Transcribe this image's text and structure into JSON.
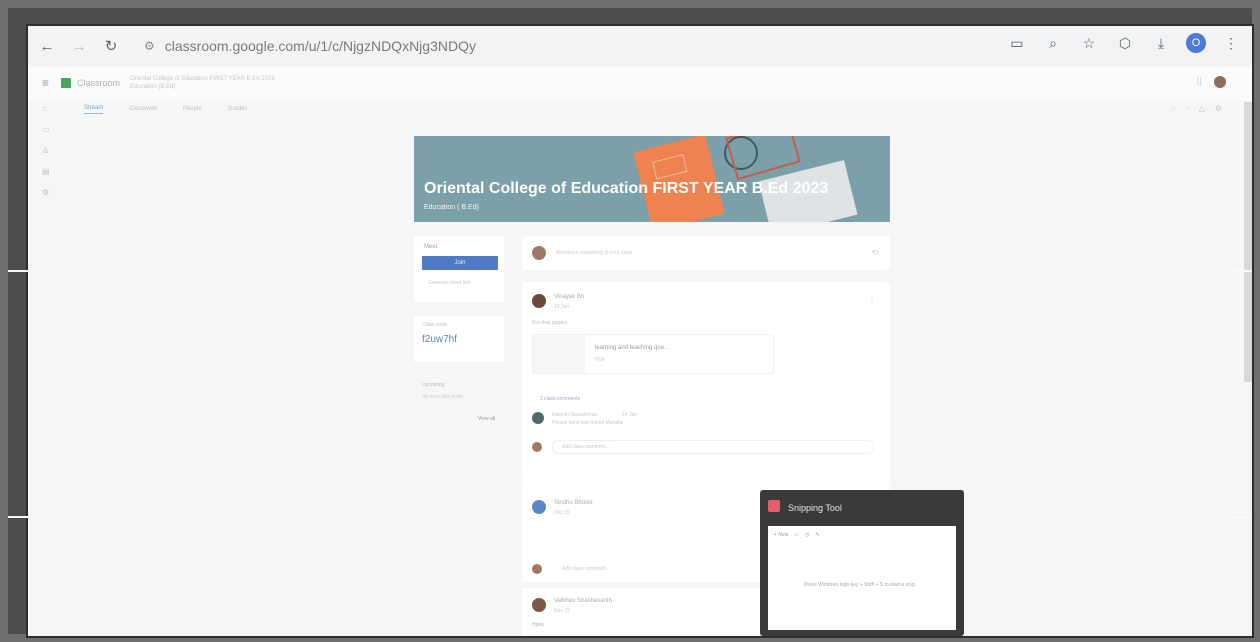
{
  "browser": {
    "url": "classroom.google.com/u/1/c/NjgzNDQxNjg3NDQy",
    "profile_initial": "O"
  },
  "classroom": {
    "app_name": "Classroom",
    "breadcrumb_course": "Oriental College of Education FIRST YEAR B.Ed 2023",
    "breadcrumb_sub": "Education (B.Ed)",
    "tabs": [
      "Stream",
      "Classwork",
      "People",
      "Grades"
    ]
  },
  "banner": {
    "title": "Oriental College of Education FIRST YEAR B.Ed 2023",
    "subtitle": "Education ( B.Ed)"
  },
  "meet": {
    "label": "Meet",
    "button": "Join",
    "link": "Generate Meet link"
  },
  "class_code": {
    "label": "Class code",
    "value": "f2uw7hf"
  },
  "upcoming": {
    "label": "Upcoming",
    "empty": "No work due soon",
    "view_all": "View all"
  },
  "stream": {
    "announce_placeholder": "Announce something to your class",
    "post1": {
      "author": "Vinayak Bn",
      "date": "10 Jan",
      "body": "Pre-final papers",
      "attachment": "learning and teaching que...",
      "attachment_type": "PDF",
      "class_comments": "2 class comments",
      "commenter": "Rakesh Narasimhan",
      "comment_time": "14 Jan",
      "comment_text": "Please send sub model Marathi",
      "comment_placeholder": "Add class comment..."
    },
    "post2": {
      "author": "Sindhu Bhosle",
      "date": "Dec 15",
      "body": "",
      "comment_placeholder": "Add class comment..."
    },
    "post3": {
      "author": "Vaibhav Shashavanth",
      "date": "Nov 15",
      "body": "Hpes"
    }
  },
  "snipping_tool": {
    "title": "Snipping Tool",
    "new_label": "+ New",
    "message": "Press Windows logo key + Shift + S to start a snip."
  },
  "colors": {
    "banner": "#7ba0a9",
    "accent": "#4f7bc5",
    "book": "#ef8251"
  }
}
